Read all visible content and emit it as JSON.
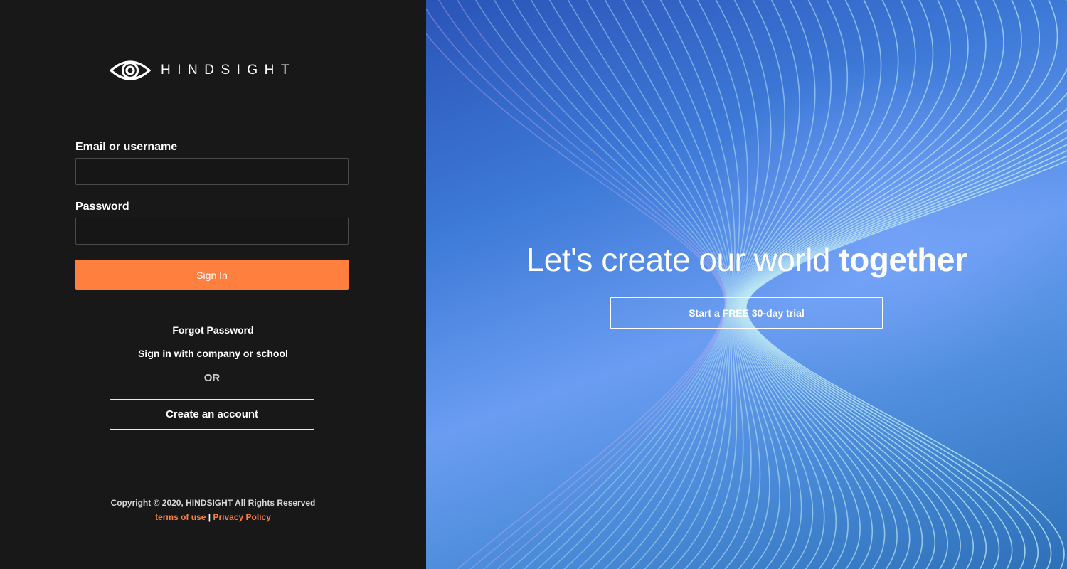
{
  "brand": {
    "name": "HINDSIGHT",
    "logo_icon": "eye-icon"
  },
  "login": {
    "email_label": "Email or username",
    "email_value": "",
    "password_label": "Password",
    "password_value": "",
    "signin_label": "Sign In",
    "forgot_label": "Forgot Password",
    "sso_label": "Sign in with company or school",
    "or_label": "OR",
    "create_label": "Create an account"
  },
  "footer": {
    "copyright": "Copyright © 2020, HINDSIGHT All Rights Reserved",
    "terms_label": "terms of use",
    "separator": "|",
    "privacy_label": "Privacy Policy"
  },
  "hero": {
    "title_regular": "Let's create our world",
    "title_bold": "together",
    "trial_label": "Start a FREE 30-day trial"
  },
  "colors": {
    "accent": "#ff7f3f",
    "panel_bg": "#181818",
    "hero_blue": "#4a86e0",
    "wave_cyan": "#5fe0e6"
  }
}
